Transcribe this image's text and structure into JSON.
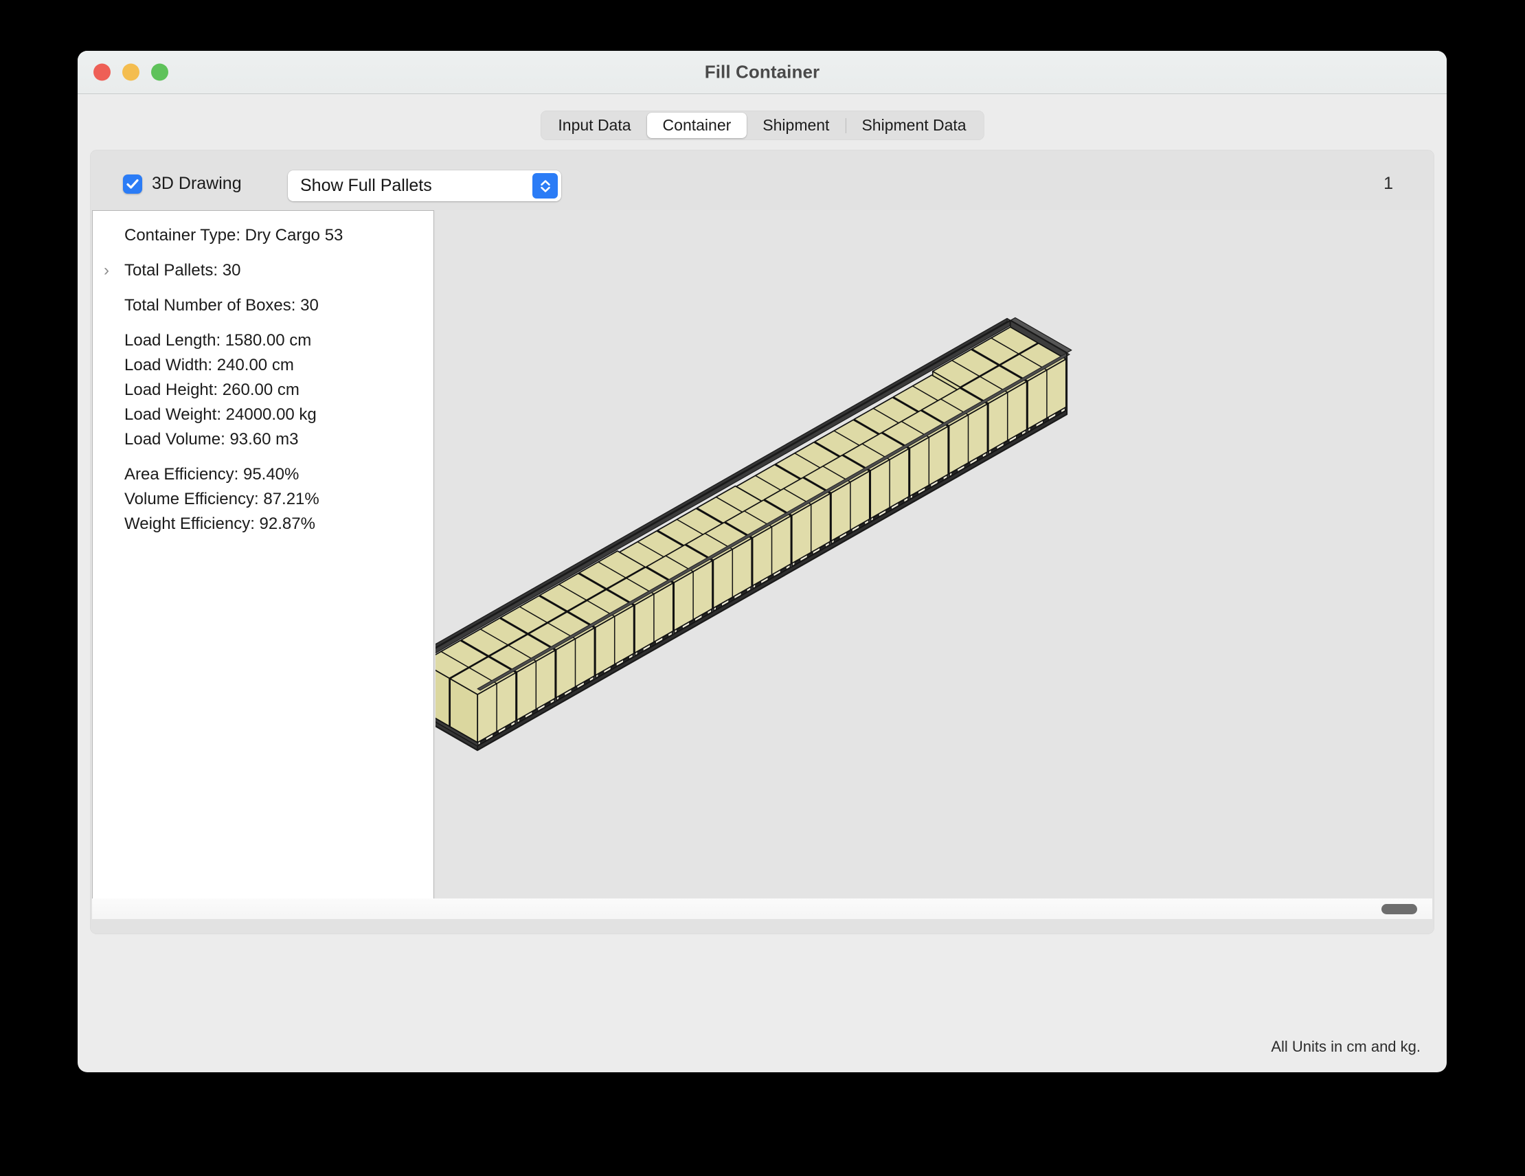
{
  "window": {
    "title": "Fill Container",
    "traffic_lights": [
      "close-red",
      "minimize-yellow",
      "zoom-green"
    ]
  },
  "tabs": [
    {
      "label": "Input Data",
      "active": false
    },
    {
      "label": "Container",
      "active": true
    },
    {
      "label": "Shipment",
      "active": false
    },
    {
      "label": "Shipment Data",
      "active": false
    }
  ],
  "controls": {
    "checkbox_label": "3D Drawing",
    "checkbox_checked": true,
    "popup_value": "Show Full Pallets",
    "popup_options": [
      "Show Full Pallets"
    ],
    "counter": "1"
  },
  "info": [
    {
      "text": "Container Type: Dry Cargo 53",
      "disclosure": false
    },
    {
      "text": "",
      "spacer": true
    },
    {
      "text": "Total Pallets: 30",
      "disclosure": true
    },
    {
      "text": "",
      "spacer": true
    },
    {
      "text": "Total Number of Boxes: 30",
      "disclosure": false
    },
    {
      "text": "",
      "spacer": true
    },
    {
      "text": "Load Length: 1580.00 cm",
      "disclosure": false
    },
    {
      "text": "Load Width: 240.00 cm",
      "disclosure": false
    },
    {
      "text": "Load Height: 260.00 cm",
      "disclosure": false
    },
    {
      "text": "Load Weight: 24000.00 kg",
      "disclosure": false
    },
    {
      "text": "Load Volume: 93.60 m3",
      "disclosure": false
    },
    {
      "text": "",
      "spacer": true
    },
    {
      "text": "Area Efficiency: 95.40%",
      "disclosure": false
    },
    {
      "text": "Volume Efficiency: 87.21%",
      "disclosure": false
    },
    {
      "text": "Weight Efficiency: 92.87%",
      "disclosure": false
    }
  ],
  "drawing": {
    "kind": "3d-isometric-container-load",
    "container_type": "Dry Cargo 53",
    "pallet_columns": 15,
    "pallets_per_column": 2,
    "total_pallets": 30,
    "box_fill": "#ddd9a4",
    "box_top_fill": "#dedaa6",
    "box_stroke": "#111111",
    "floor_fill": "#3a3a3a",
    "wall_fill": "#414141",
    "background": "#e4e4e4"
  },
  "footer": {
    "units_note": "All Units in cm and kg."
  },
  "scrollbar": {
    "orientation": "horizontal",
    "thumb_position": "right"
  }
}
